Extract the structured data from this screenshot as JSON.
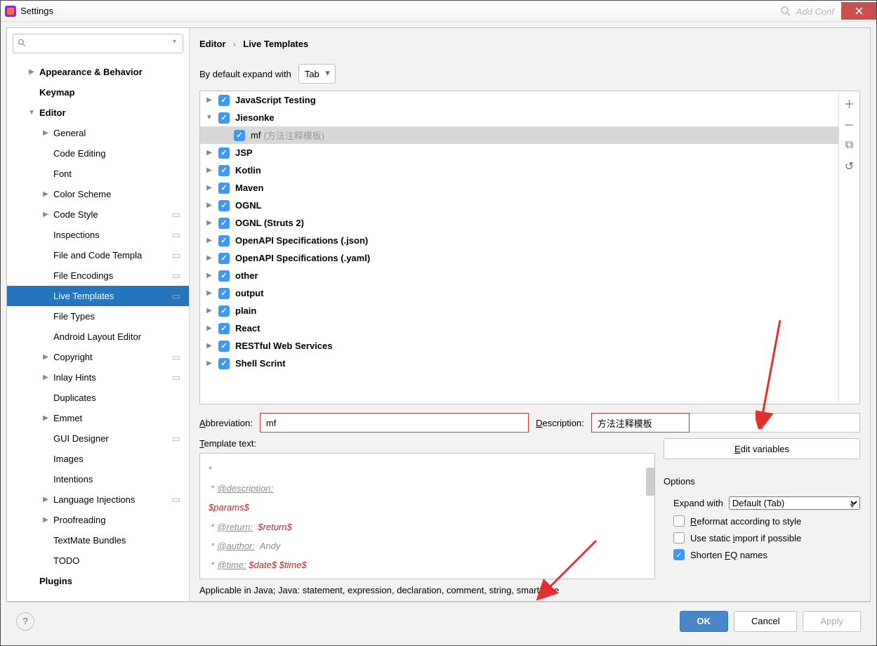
{
  "title": "Settings",
  "topright_hint": "Add Conf",
  "search_placeholder": "",
  "sidebar": [
    {
      "label": "Appearance & Behavior",
      "bold": true,
      "arrow": "▶",
      "lvl": 0
    },
    {
      "label": "Keymap",
      "bold": true,
      "lvl": 0
    },
    {
      "label": "Editor",
      "bold": true,
      "arrow": "▼",
      "lvl": 0
    },
    {
      "label": "General",
      "arrow": "▶",
      "lvl": 1
    },
    {
      "label": "Code Editing",
      "lvl": 1
    },
    {
      "label": "Font",
      "lvl": 1
    },
    {
      "label": "Color Scheme",
      "arrow": "▶",
      "lvl": 1
    },
    {
      "label": "Code Style",
      "arrow": "▶",
      "lvl": 1,
      "cfg": true
    },
    {
      "label": "Inspections",
      "lvl": 1,
      "cfg": true
    },
    {
      "label": "File and Code Templa",
      "lvl": 1,
      "cfg": true
    },
    {
      "label": "File Encodings",
      "lvl": 1,
      "cfg": true
    },
    {
      "label": "Live Templates",
      "lvl": 1,
      "cfg": true,
      "selected": true
    },
    {
      "label": "File Types",
      "lvl": 1
    },
    {
      "label": "Android Layout Editor",
      "lvl": 1
    },
    {
      "label": "Copyright",
      "arrow": "▶",
      "lvl": 1,
      "cfg": true
    },
    {
      "label": "Inlay Hints",
      "arrow": "▶",
      "lvl": 1,
      "cfg": true
    },
    {
      "label": "Duplicates",
      "lvl": 1
    },
    {
      "label": "Emmet",
      "arrow": "▶",
      "lvl": 1
    },
    {
      "label": "GUI Designer",
      "lvl": 1,
      "cfg": true
    },
    {
      "label": "Images",
      "lvl": 1
    },
    {
      "label": "Intentions",
      "lvl": 1
    },
    {
      "label": "Language Injections",
      "arrow": "▶",
      "lvl": 1,
      "cfg": true
    },
    {
      "label": "Proofreading",
      "arrow": "▶",
      "lvl": 1
    },
    {
      "label": "TextMate Bundles",
      "lvl": 1
    },
    {
      "label": "TODO",
      "lvl": 1
    },
    {
      "label": "Plugins",
      "bold": true,
      "lvl": 0
    }
  ],
  "breadcrumb": {
    "a": "Editor",
    "b": "Live Templates"
  },
  "expand_label": "By default expand with",
  "expand_value": "Tab",
  "templates": [
    {
      "label": "JavaScript Testing",
      "arrow": "▶",
      "d": 1
    },
    {
      "label": "Jiesonke",
      "arrow": "▼",
      "d": 1
    },
    {
      "label": "mf",
      "hint": "(方法注释模板)",
      "d": 2,
      "sel": true
    },
    {
      "label": "JSP",
      "arrow": "▶",
      "d": 1
    },
    {
      "label": "Kotlin",
      "arrow": "▶",
      "d": 1
    },
    {
      "label": "Maven",
      "arrow": "▶",
      "d": 1
    },
    {
      "label": "OGNL",
      "arrow": "▶",
      "d": 1
    },
    {
      "label": "OGNL (Struts 2)",
      "arrow": "▶",
      "d": 1
    },
    {
      "label": "OpenAPI Specifications (.json)",
      "arrow": "▶",
      "d": 1
    },
    {
      "label": "OpenAPI Specifications (.yaml)",
      "arrow": "▶",
      "d": 1
    },
    {
      "label": "other",
      "arrow": "▶",
      "d": 1
    },
    {
      "label": "output",
      "arrow": "▶",
      "d": 1
    },
    {
      "label": "plain",
      "arrow": "▶",
      "d": 1
    },
    {
      "label": "React",
      "arrow": "▶",
      "d": 1
    },
    {
      "label": "RESTful Web Services",
      "arrow": "▶",
      "d": 1
    },
    {
      "label": "Shell Scrint",
      "arrow": "▶",
      "d": 1
    }
  ],
  "abbrev_label": "Abbreviation:",
  "abbrev_value": "mf",
  "desc_label": "Description:",
  "desc_value": "方法注释模板",
  "template_text_label": "Template text:",
  "edit_vars": "Edit variables",
  "options_label": "Options",
  "expand_with_label": "Expand with",
  "expand_with_value": "Default (Tab)",
  "opt_reformat": "Reformat according to style",
  "opt_static": "Use static import if possible",
  "opt_shorten": "Shorten FQ names",
  "applicable": "Applicable in Java; Java: statement, expression, declaration, comment, string, smart type",
  "buttons": {
    "ok": "OK",
    "cancel": "Cancel",
    "apply": "Apply"
  },
  "template_body": {
    "l1": "*",
    "l2a": " * ",
    "l2b": "@description:",
    "l3": "$params$",
    "l4a": " * ",
    "l4b": "@return:",
    "l4c": "  $return$",
    "l5a": " * ",
    "l5b": "@author:",
    "l5c": "  Andy",
    "l6a": " * ",
    "l6b": "@time:",
    "l6c": " $date$ $time$"
  }
}
